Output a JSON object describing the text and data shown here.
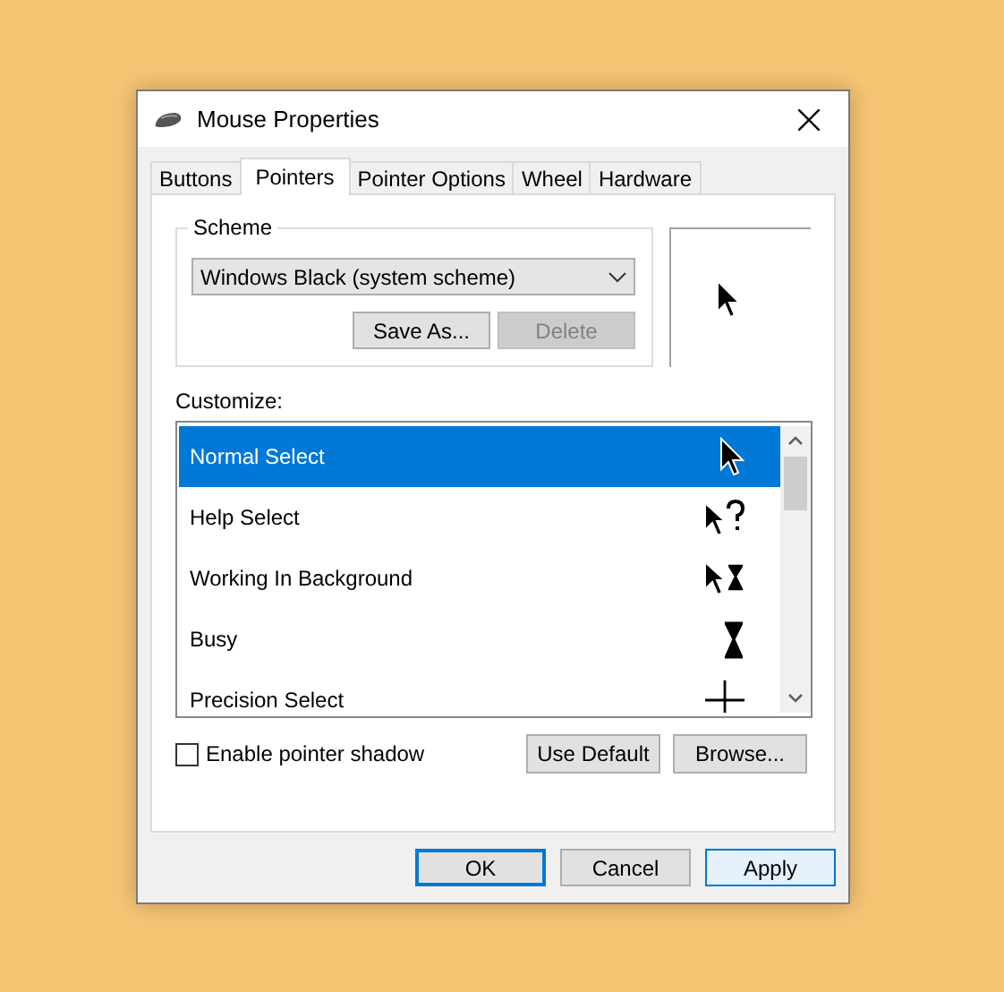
{
  "window": {
    "title": "Mouse Properties"
  },
  "tabs": [
    {
      "label": "Buttons",
      "selected": false
    },
    {
      "label": "Pointers",
      "selected": true
    },
    {
      "label": "Pointer Options",
      "selected": false
    },
    {
      "label": "Wheel",
      "selected": false
    },
    {
      "label": "Hardware",
      "selected": false
    }
  ],
  "scheme": {
    "label": "Scheme",
    "value": "Windows Black (system scheme)",
    "buttons": [
      {
        "label": "Save As...",
        "disabled": false
      },
      {
        "label": "Delete",
        "disabled": true
      }
    ]
  },
  "preview": {
    "kind": "arrow"
  },
  "customize": {
    "label": "Customize:",
    "rows": [
      {
        "name": "Normal Select",
        "kind": "arrow",
        "selected": true
      },
      {
        "name": "Help Select",
        "kind": "help",
        "selected": false
      },
      {
        "name": "Working In Background",
        "kind": "working",
        "selected": false
      },
      {
        "name": "Busy",
        "kind": "busy",
        "selected": false
      },
      {
        "name": "Precision Select",
        "kind": "crosshair",
        "selected": false
      }
    ]
  },
  "shadow": {
    "label": "Enable pointer shadow",
    "checked": false
  },
  "list_buttons": [
    "Use Default",
    "Browse..."
  ],
  "dialog_buttons": [
    {
      "label": "OK",
      "kind": "default"
    },
    {
      "label": "Cancel",
      "kind": "plain"
    },
    {
      "label": "Apply",
      "kind": "hover"
    }
  ]
}
